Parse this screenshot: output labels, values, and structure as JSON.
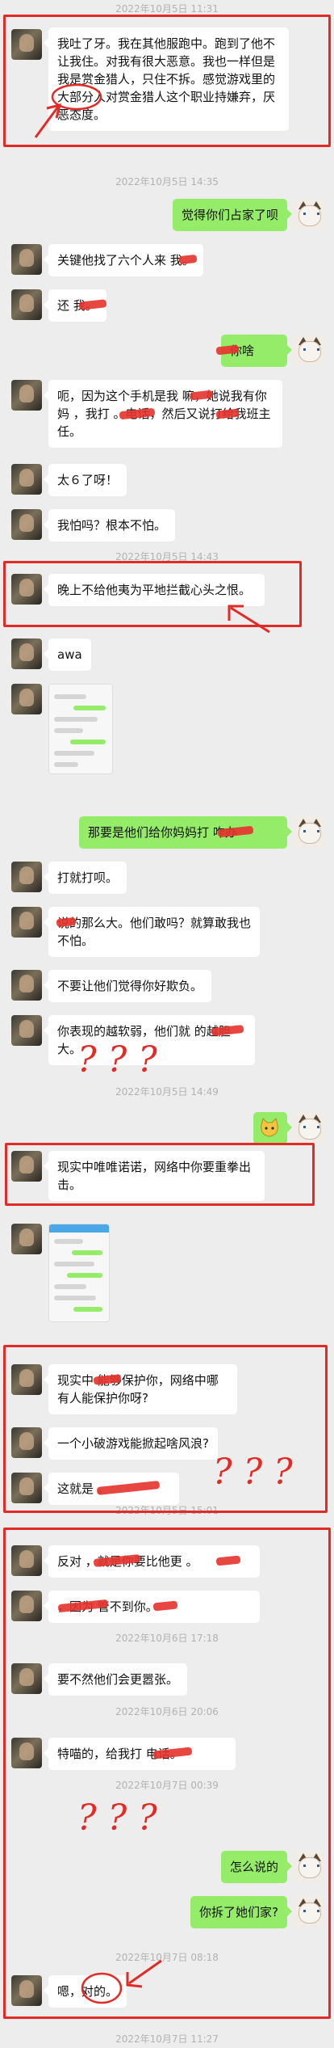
{
  "timestamps": {
    "t1": "2022年10月5日 11:31",
    "t2": "2022年10月5日 14:35",
    "t3": "2022年10月5日 14:43",
    "t4": "2022年10月5日 14:49",
    "t5": "2022年10月5日 15:01",
    "t6": "2022年10月6日 17:18",
    "t7": "2022年10月6日 20:06",
    "t8": "2022年10月7日 00:39",
    "t9": "2022年10月7日 08:18",
    "t10": "2022年10月7日 11:27"
  },
  "messages": {
    "m1": "我吐了牙。我在其他服跑中。跑到了他不让我住。对我有很大恶意。我也一样但是我是赏金猎人，只住不拆。感觉游戏里的大部分人对赏金猎人这个职业持嫌弃，厌恶态度。",
    "m2": "觉得你们占家了呗",
    "m3": "关键他找了六个人来 我。",
    "m4": "还 我。",
    "m5": " 你啥",
    "m6": "呃，因为这个手机是我 嘛，她说我有你妈 ，我打 。电话，然后又说打给我班主任。",
    "m7": "太６了呀！",
    "m8": "我怕吗？根本不怕。",
    "m9": "晚上不给他夷为平地拦截心头之恨。",
    "m10": "awa",
    "m11": "那要是他们给你妈妈打 咋办",
    "m12": "打就打呗。",
    "m13": " 说的那么大。他们敢吗？就算敢我也不怕。",
    "m14": "不要让他们觉得你好欺负。",
    "m15": "你表现的越软弱，他们就 的越胆大。",
    "m16": "现实中唯唯诺诺，网络中你要重拳出击。",
    "m17": "现实中 能够保护你，网络中哪有人能保护你呀?",
    "m18": "一个小破游戏能掀起啥风浪?",
    "m19": "这就是 。",
    "m20": "反对 ，就是你要比他更 。",
    "m21": " ，因为 管不到你。",
    "m22": "要不然他们会更嚣张。",
    "m23": "特喵的，给我打 电话。",
    "m24": "怎么说的",
    "m25": "你拆了她们家?",
    "m26": "嗯，对的。"
  },
  "annotations": {
    "q1": "? ? ?",
    "q2": "? ? ?",
    "q3": "? ? ?"
  }
}
